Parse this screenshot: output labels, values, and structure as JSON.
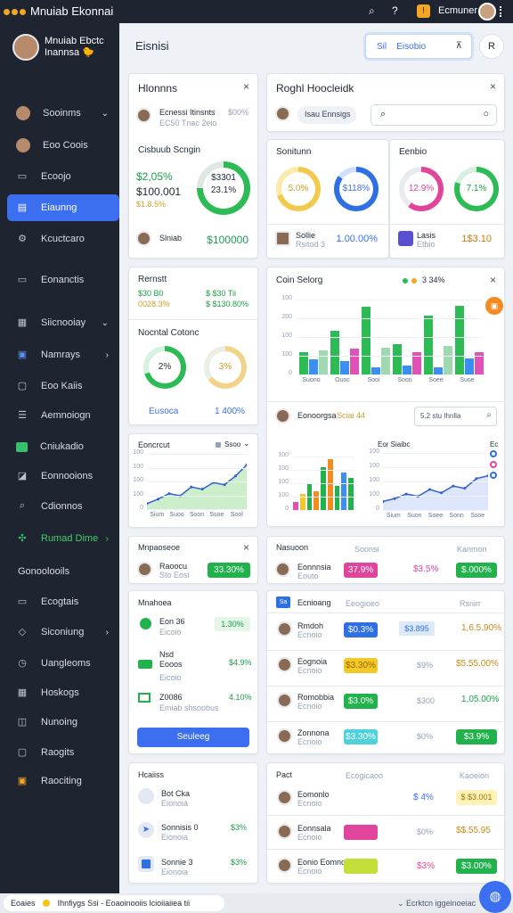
{
  "topbar": {
    "title": "Mnuiab Ekonnai",
    "user": "Ecmuner"
  },
  "sidebar": {
    "profile_name": "Mnuiab Ebctc Inannsa 🐤",
    "items": [
      {
        "label": "Sooinms",
        "chevron": "⌄"
      },
      {
        "label": "Eoo Coois",
        "chevron": ""
      },
      {
        "label": "Ecoojo",
        "chevron": ""
      },
      {
        "label": "Eiaunng",
        "chevron": ""
      },
      {
        "label": "Kcuctcaro",
        "chevron": ""
      },
      {
        "label": "Eonanctis",
        "chevron": ""
      },
      {
        "label": "Siicnooiay",
        "chevron": "⌄"
      },
      {
        "label": "Namrays",
        "chevron": "›"
      },
      {
        "label": "Eoo Kaiis",
        "chevron": ""
      },
      {
        "label": "Aemnoiogn",
        "chevron": ""
      },
      {
        "label": "Cniukadio",
        "chevron": ""
      },
      {
        "label": "Eonnooions",
        "chevron": ""
      },
      {
        "label": "Cdionnos",
        "chevron": ""
      },
      {
        "label": "Rumad Dime",
        "chevron": "›"
      },
      {
        "label": "Gonoolooils",
        "chevron": ""
      },
      {
        "label": "Ecogtais",
        "chevron": ""
      },
      {
        "label": "Siconiung",
        "chevron": "›"
      },
      {
        "label": "Uangleoms",
        "chevron": ""
      },
      {
        "label": "Hoskogs",
        "chevron": ""
      },
      {
        "label": "Nunoing",
        "chevron": ""
      },
      {
        "label": "Raogits",
        "chevron": ""
      },
      {
        "label": "Raociting",
        "chevron": ""
      }
    ]
  },
  "header": {
    "title": "Eisnisi",
    "search_label": "Sil",
    "search_value": "Eisobio",
    "search_close": "⊼",
    "user_btn": "R"
  },
  "card1": {
    "title": "Hlonnns",
    "close": "×",
    "row1_name": "Ecnessi Itinsnts",
    "row1_sub": "EC50 Tnac 2eio",
    "row1_val": "$00%",
    "section": "Cisbuub Scngin",
    "v1": "$2,05%",
    "v2": "$100.001",
    "v3": "$1.8.5%",
    "ring_top": "$3301",
    "ring_bot": "23.1%",
    "foot_name": "Slniab",
    "foot_val": "$100000"
  },
  "card2": {
    "title": "Roghl Hoocleidk",
    "close": "×",
    "tag": "Isau Ennsigs",
    "search_placeholder": "",
    "search_icon": "⌕"
  },
  "card3": {
    "title": "Sonitunn",
    "r1": "5.0%",
    "r2": "$118%",
    "name": "Sollie",
    "sub": "Rsitod 3",
    "val": "1.00.00%"
  },
  "card4": {
    "title": "Eenbio",
    "r1": "12.9%",
    "r2": "7.1%",
    "tag": "Lasis",
    "sub": "Etbio",
    "val": "1$3.10"
  },
  "card5": {
    "title": "Rernstt",
    "c1a": "$30 B0",
    "c1b": "0028.3%",
    "c2a": "$ $30 Tii",
    "c2b": "$ $130.80%",
    "section": "Nocntal Cotonc",
    "r1": "2%",
    "r2": "3%",
    "f1": "Eusoca",
    "f2": "1 400%"
  },
  "card6": {
    "title": "Coin Selorg",
    "legend": "3 34%",
    "close": "×",
    "yticks": [
      "100",
      "200",
      "100",
      "100",
      "0"
    ],
    "xticks": [
      "Suono",
      "Ouoc",
      "Sooi",
      "Soon",
      "Soee",
      "Suoe"
    ],
    "chart_data": {
      "type": "bar",
      "categories": [
        "Suono",
        "Ouoc",
        "Sooi",
        "Soon",
        "Soee",
        "Suoe"
      ],
      "series": [
        {
          "values": [
            30,
            58,
            90,
            40,
            78,
            92
          ]
        },
        {
          "values": [
            20,
            18,
            10,
            12,
            10,
            22
          ]
        },
        {
          "values": [
            32,
            34,
            36,
            30,
            38,
            30
          ]
        }
      ]
    },
    "foot_name": "Eonoorgsa",
    "foot_tag": "Sciai 44",
    "search_value": "5.2 stu Ihnlla"
  },
  "card7": {
    "title": "Eoncrcut",
    "legend": "Ssoo",
    "yticks": [
      "100",
      "100",
      "100",
      "100",
      "0"
    ],
    "xticks": [
      "Sium",
      "Suoo",
      "Soon",
      "Ssoe",
      "Sool"
    ],
    "chart_data": {
      "type": "area",
      "values": [
        10,
        18,
        28,
        24,
        40,
        36,
        48,
        44,
        60,
        80
      ]
    }
  },
  "card8": {
    "title": "Eco Ssaiuonus",
    "yticks": [
      "100",
      "100",
      "100",
      "100",
      "0"
    ],
    "chart_data": {
      "type": "bar",
      "values": [
        15,
        30,
        50,
        35,
        80,
        95,
        45,
        70,
        60
      ]
    }
  },
  "card9": {
    "title": "Eor Siaibc",
    "legend": "Ec",
    "yticks": [
      "100",
      "100",
      "100",
      "100",
      "0"
    ],
    "xticks": [
      "Sium",
      "Suon",
      "Soee",
      "Sonn",
      "Ssoe"
    ],
    "chart_data": {
      "type": "line",
      "values": [
        15,
        20,
        28,
        24,
        36,
        30,
        42,
        38,
        55,
        60
      ]
    }
  },
  "card10": {
    "title": "Mnpaoseoe",
    "close": "×",
    "name": "Raoocu",
    "sub": "Sto Eosi",
    "val": "33.30%"
  },
  "card11": {
    "title": "Nasuoon",
    "c1": "Soonsi",
    "c2": "Kanmon",
    "row": {
      "name": "Eonnnsia",
      "sub": "Eouto",
      "pill": "37.9%",
      "pct": "$3.5%",
      "val": "$.000%"
    }
  },
  "card12": {
    "title": "Mnahoea",
    "items": [
      {
        "name": "Eon 36",
        "sub": "Eicoio",
        "val": "1.30%"
      },
      {
        "name": "Nsd Eooos",
        "sub": "Eicoio",
        "val": "$4.9%"
      },
      {
        "name": "Z0086",
        "sub": "Emiab shsoobus",
        "val": "4.10%"
      }
    ],
    "btn": "Seuleeg"
  },
  "card13": {
    "tag": "Sa",
    "title": "Ecnioang",
    "c1": "Eeogioeo",
    "c2": "Rsnirr",
    "rows": [
      {
        "name": "Rmdoh",
        "sub": "Ecnoio",
        "pill": "$0.3%",
        "pct": "$3.895",
        "val": "1,6.5.90%"
      },
      {
        "name": "Eognoia",
        "sub": "Ecnoio",
        "pill": "$3.30%",
        "pct": "$9%",
        "val": "$5.55.00%"
      },
      {
        "name": "Romobbia",
        "sub": "Ecnoio",
        "pill": "$3.0%",
        "pct": "$300",
        "val": "1,05.00%"
      },
      {
        "name": "Zonnona",
        "sub": "Ecnoio",
        "pill": "$3.30%",
        "pct": "$0%",
        "val": "$3.9%"
      }
    ]
  },
  "card14": {
    "title": "Hcaiiss",
    "items": [
      {
        "name": "Bot Cka",
        "sub": "Eionoia",
        "val": ""
      },
      {
        "name": "Sonnisis 0",
        "sub": "Eionoia",
        "val": "$3%"
      },
      {
        "name": "Sonnie 3",
        "sub": "Eionoia",
        "val": "$3%"
      }
    ]
  },
  "card15": {
    "title": "Pact",
    "c1": "Ecogicaoo",
    "c2": "Kaoeion",
    "rows": [
      {
        "name": "Eomonlo",
        "sub": "Ecnoio",
        "pct": "$ 4%",
        "val": "$ $3.001"
      },
      {
        "name": "Eonnsala",
        "sub": "Ecnoio",
        "pct": "$0%",
        "val": "$$.55.95"
      },
      {
        "name": "Eonio Eomnoo",
        "sub": "Ecnoio",
        "pct": "$3%",
        "val": "$3.00%"
      }
    ]
  },
  "footer": {
    "left": "Eoaies",
    "mid": "Ihnfiygs Ssi - Eoaoinooiis lcioiiaiiea tii",
    "right": "Ecrktcn iggeinoeiac"
  }
}
